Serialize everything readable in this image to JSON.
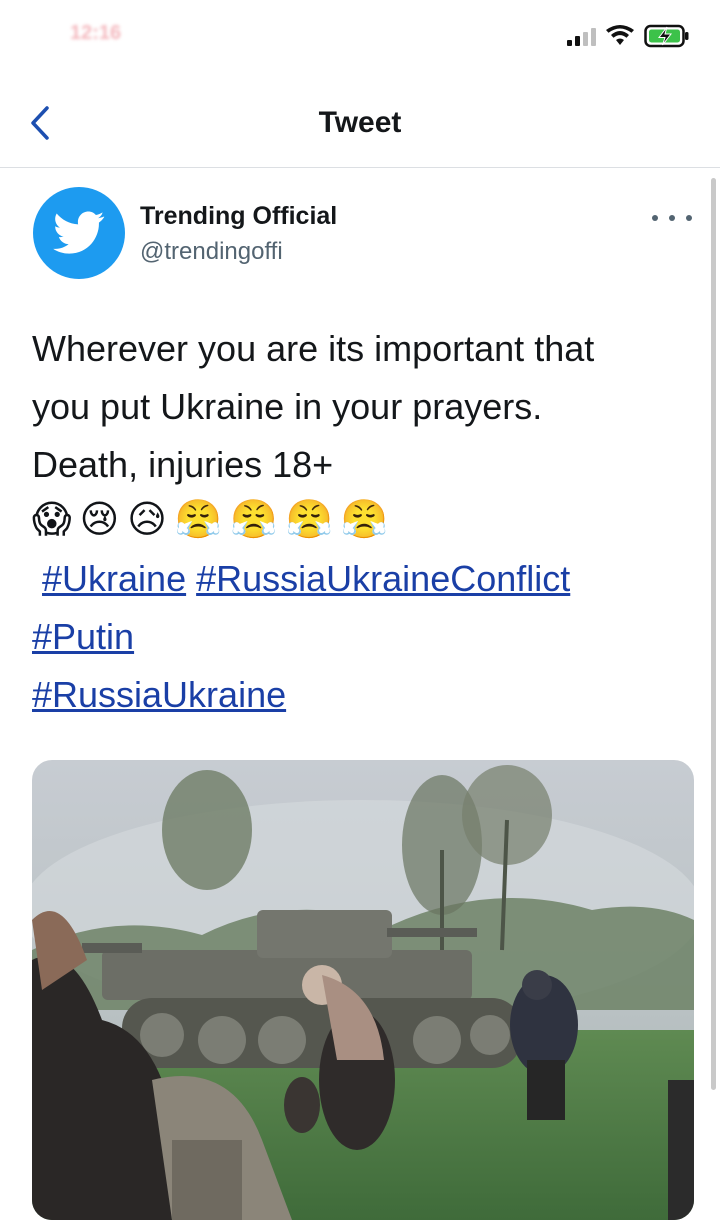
{
  "status_bar": {
    "time": "12:16",
    "icons": [
      "signal-icon",
      "wifi-icon",
      "battery-charging-icon"
    ]
  },
  "nav": {
    "title": "Tweet",
    "back_icon": "chevron-left-icon"
  },
  "tweet": {
    "author": {
      "name": "Trending Official",
      "handle": "@trendingoffi",
      "avatar_icon": "twitter-bird-icon"
    },
    "more_icon": "more-horizontal-icon",
    "text_lines": [
      "Wherever you are its important that",
      "you put Ukraine in your prayers.",
      "Death, injuries 18+"
    ],
    "emojis": [
      "😱",
      "😢",
      "😥",
      "😤",
      "😤",
      "😤",
      "😤"
    ],
    "hashtags": {
      "ukraine": "#Ukraine",
      "conflict": "#RussiaUkraineConflict",
      "putin": "#Putin",
      "russia_ukraine": "#RussiaUkraine"
    },
    "media": {
      "kind": "video-thumbnail",
      "description_icon": "video-thumbnail-image"
    }
  },
  "colors": {
    "accent": "#1d9bf0",
    "hashtag": "#1a3fa6",
    "text": "#14171a",
    "secondary_text": "#536471"
  }
}
